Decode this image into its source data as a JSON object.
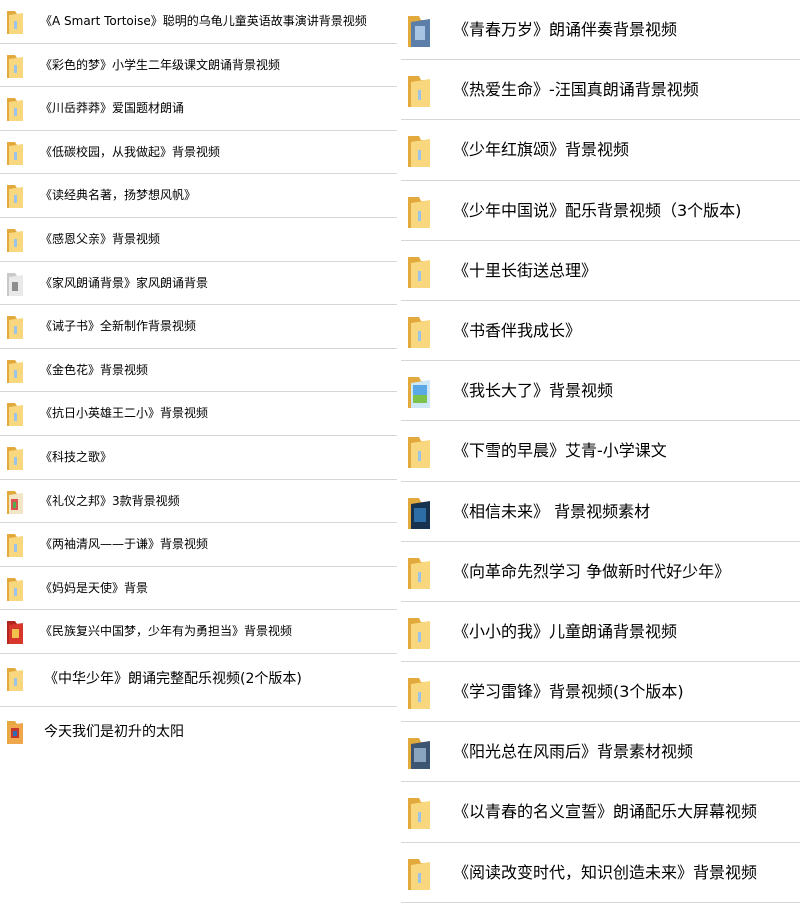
{
  "left_items": [
    {
      "label": "《A Smart Tortoise》聪明的乌龟儿童英语故事演讲背景视频",
      "icon": "folder-icon"
    },
    {
      "label": "《彩色的梦》小学生二年级课文朗诵背景视频",
      "icon": "folder-icon"
    },
    {
      "label": "《川岳莽莽》爱国题材朗诵",
      "icon": "folder-icon"
    },
    {
      "label": "《低碳校园，从我做起》背景视频",
      "icon": "folder-icon"
    },
    {
      "label": "《读经典名著，扬梦想风帆》",
      "icon": "folder-icon"
    },
    {
      "label": "《感恩父亲》背景视频",
      "icon": "folder-icon"
    },
    {
      "label": "《家风朗诵背景》家风朗诵背景",
      "icon": "folder-thumbnail-icon"
    },
    {
      "label": "《诫子书》全新制作背景视频",
      "icon": "folder-icon"
    },
    {
      "label": "《金色花》背景视频",
      "icon": "folder-icon"
    },
    {
      "label": "《抗日小英雄王二小》背景视频",
      "icon": "folder-icon"
    },
    {
      "label": "《科技之歌》",
      "icon": "folder-icon"
    },
    {
      "label": "《礼仪之邦》3款背景视频",
      "icon": "folder-thumbnail-icon"
    },
    {
      "label": "《两袖清风——于谦》背景视频",
      "icon": "folder-icon"
    },
    {
      "label": "《妈妈是天使》背景",
      "icon": "folder-icon"
    },
    {
      "label": "《民族复兴中国梦，少年有为勇担当》背景视频",
      "icon": "folder-thumbnail-icon"
    },
    {
      "label": "《中华少年》朗诵完整配乐视频(2个版本)",
      "icon": "folder-icon"
    },
    {
      "label": "今天我们是初升的太阳",
      "icon": "folder-thumbnail-icon"
    }
  ],
  "right_items": [
    {
      "label": "《青春万岁》朗诵伴奏背景视频",
      "icon": "folder-thumbnail-icon"
    },
    {
      "label": "《热爱生命》-汪国真朗诵背景视频",
      "icon": "folder-icon"
    },
    {
      "label": "《少年红旗颂》背景视频",
      "icon": "folder-icon"
    },
    {
      "label": "《少年中国说》配乐背景视频（3个版本)",
      "icon": "folder-icon"
    },
    {
      "label": "《十里长街送总理》",
      "icon": "folder-icon"
    },
    {
      "label": "《书香伴我成长》",
      "icon": "folder-icon"
    },
    {
      "label": "《我长大了》背景视频",
      "icon": "folder-thumbnail-icon"
    },
    {
      "label": "《下雪的早晨》艾青-小学课文",
      "icon": "folder-icon"
    },
    {
      "label": "《相信未来》 背景视频素材",
      "icon": "folder-thumbnail-icon"
    },
    {
      "label": "《向革命先烈学习 争做新时代好少年》",
      "icon": "folder-icon"
    },
    {
      "label": "《小小的我》儿童朗诵背景视频",
      "icon": "folder-icon"
    },
    {
      "label": "《学习雷锋》背景视频(3个版本)",
      "icon": "folder-icon"
    },
    {
      "label": "《阳光总在风雨后》背景素材视频",
      "icon": "folder-thumbnail-icon"
    },
    {
      "label": "《以青春的名义宣誓》朗诵配乐大屏幕视频",
      "icon": "folder-icon"
    },
    {
      "label": "《阅读改变时代，知识创造未来》背景视频",
      "icon": "folder-icon"
    }
  ],
  "colors": {
    "folder_back": "#e8b64a",
    "folder_front": "#f7d57d",
    "divider": "#d6d6d6"
  }
}
